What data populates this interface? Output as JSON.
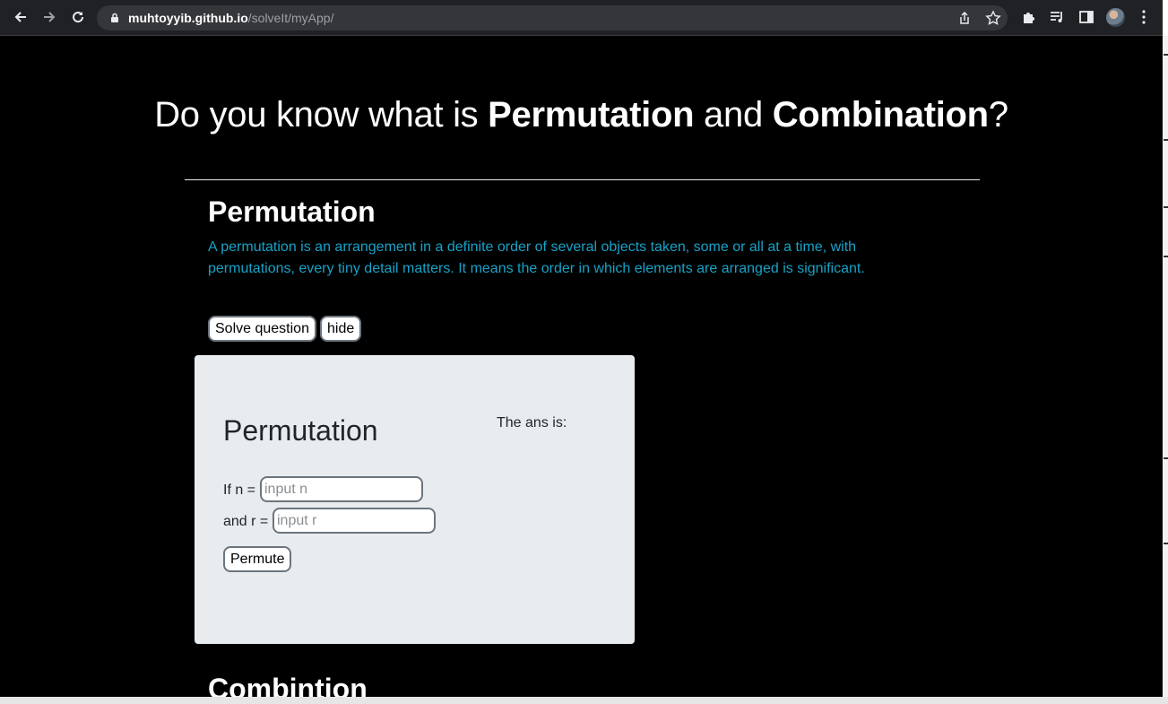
{
  "browser": {
    "url_host": "muhtoyyib.github.io",
    "url_path": "/solveIt/myApp/"
  },
  "page": {
    "title_part1": "Do you know what is ",
    "title_bold1": "Permutation",
    "title_part2": " and ",
    "title_bold2": "Combination",
    "title_part3": "?",
    "permutation_heading": "Permutation",
    "permutation_description": "A permutation is an arrangement in a definite order of several objects taken, some or all at a time, with permutations, every tiny detail matters. It means the order in which elements are arranged is significant.",
    "solve_button": "Solve question",
    "hide_button": "hide",
    "card": {
      "title": "Permutation",
      "ans_label": "The ans is:",
      "n_label": "If n =",
      "n_placeholder": "input n",
      "r_label": "and r =",
      "r_placeholder": "input r",
      "permute_button": "Permute"
    },
    "combination_heading": "Combintion"
  },
  "colors": {
    "page_background": "#000000",
    "description_text": "#17a2c7",
    "card_background": "#e9ecef"
  }
}
